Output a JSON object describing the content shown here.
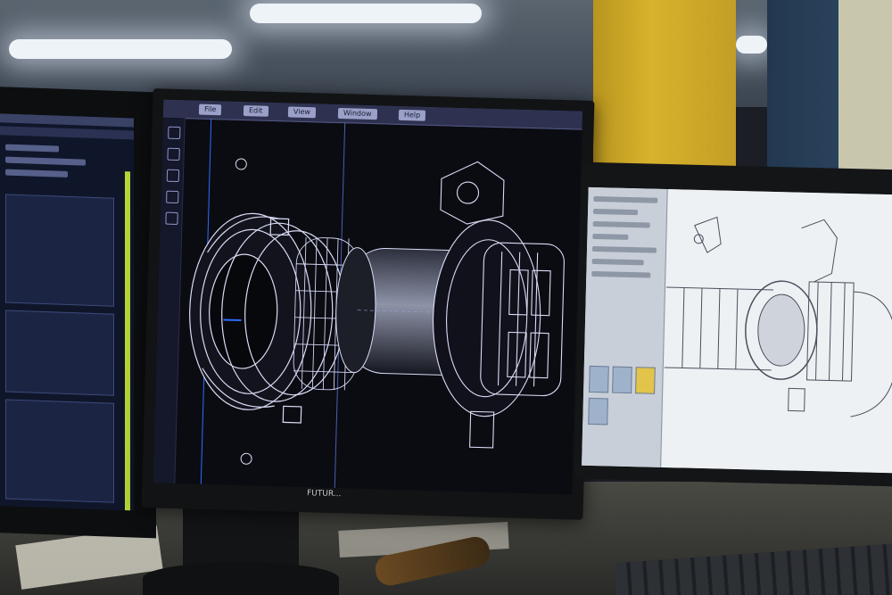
{
  "scene": {
    "description_colors": {
      "cad_background": "#0b0c12",
      "wireframe": "#d9dcf5",
      "accent_blue": "#2f6bff",
      "ui_toolbar": "#2e3250",
      "right_screen_background": "#eef1f4",
      "yellow_pillar": "#d8b22c"
    }
  },
  "center_monitor": {
    "toolbar_tabs": [
      "File",
      "Edit",
      "View",
      "Window",
      "Help"
    ],
    "brand_label": "FUTUR...",
    "icons": [
      "select-tool-icon",
      "move-tool-icon",
      "rotate-tool-icon",
      "measure-tool-icon",
      "layer-icon"
    ]
  },
  "right_monitor": {
    "sidebar_thumbnail_colors": [
      "#9fb2cc",
      "#9fb2cc",
      "#e3c44a",
      "#9fb2cc"
    ]
  }
}
